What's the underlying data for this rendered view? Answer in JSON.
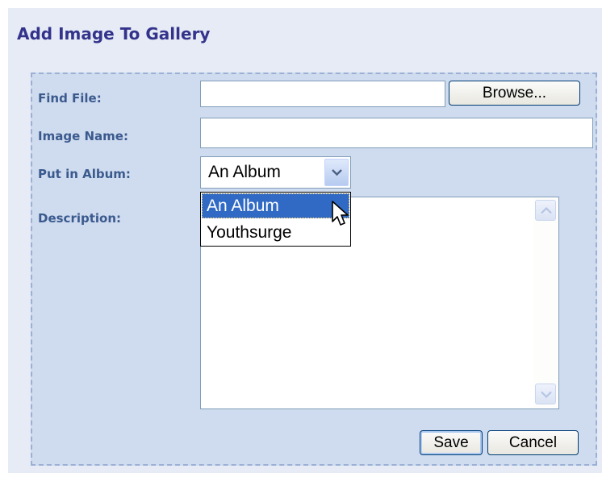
{
  "title": "Add Image To Gallery",
  "form": {
    "find_file_label": "Find File:",
    "find_file_value": "",
    "browse_label": "Browse...",
    "image_name_label": "Image Name:",
    "image_name_value": "",
    "album_label": "Put in Album:",
    "album_selected": "An Album",
    "album_options": [
      "An Album",
      "Youthsurge"
    ],
    "description_label": "Description:",
    "description_value": "",
    "save_label": "Save",
    "cancel_label": "Cancel"
  },
  "colors": {
    "title": "#33338c",
    "label": "#3a5a8e",
    "panel_bg": "#e6ebf5",
    "fieldset_bg": "#cfdbee",
    "selection": "#316ac5"
  },
  "icons": {
    "select_arrow": "chevron-down-icon",
    "scroll_up": "arrow-up-icon",
    "scroll_down": "arrow-down-icon",
    "cursor": "mouse-pointer-icon"
  }
}
